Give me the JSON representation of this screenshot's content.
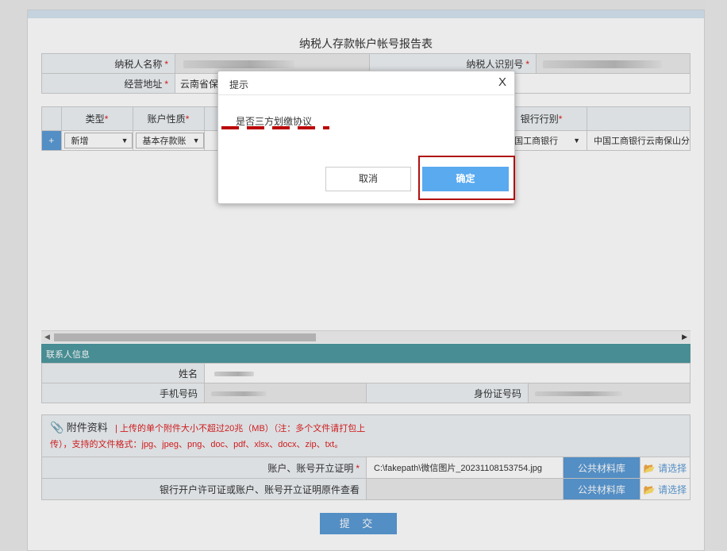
{
  "form": {
    "title": "纳税人存款帐户帐号报告表",
    "taxpayer_name_label": "纳税人名称",
    "taxpayer_id_label": "纳税人识别号",
    "address_label": "经营地址",
    "address_value": "云南省保山",
    "required_mark": "*"
  },
  "accounts_table": {
    "headers": {
      "type": "类型",
      "nature": "账户性质",
      "bank_type": "银行行别"
    },
    "row": {
      "plus": "+",
      "type_value": "新增",
      "nature_value": "基本存款账",
      "bank_value": "中国工商银行",
      "branch_value": "中国工商银行云南保山分"
    }
  },
  "contact": {
    "section_title": "联系人信息",
    "name_label": "姓名",
    "phone_label": "手机号码",
    "id_card_label": "身份证号码"
  },
  "attachments": {
    "title": "附件资料",
    "note": "| 上传的单个附件大小不超过20兆（MB）（注：多个文件请打包上传），支持的文件格式：jpg、jpeg、png、doc、pdf、xlsx、docx、zip、txt。",
    "row1_label": "账户、账号开立证明",
    "row1_file": "C:\\fakepath\\微信图片_20231108153754.jpg",
    "row2_label": "银行开户许可证或账户、账号开立证明原件查看",
    "library_button": "公共材料库",
    "choose_button": "请选择"
  },
  "submit_label": "提 交",
  "dialog": {
    "title": "提示",
    "close": "X",
    "message": "是否三方划缴协议",
    "cancel_label": "取消",
    "ok_label": "确定"
  },
  "colors": {
    "accent": "#5b9bd5",
    "dialog_ok": "#5aaaf0",
    "highlight": "#b01010",
    "section_bar": "#4e9aa0"
  }
}
